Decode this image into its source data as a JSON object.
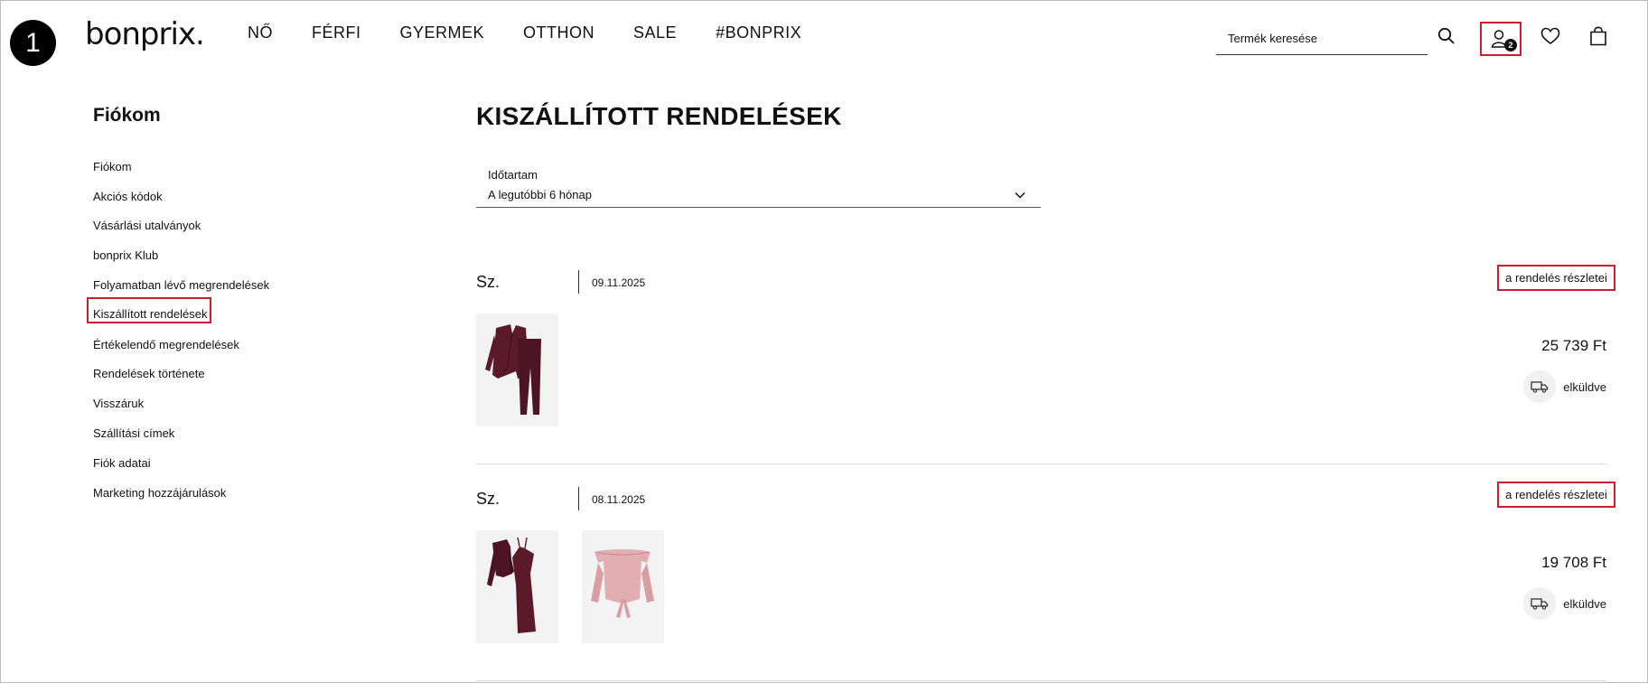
{
  "step": "1",
  "header": {
    "logo": "bonprix.",
    "nav": [
      "NŐ",
      "FÉRFI",
      "GYERMEK",
      "OTTHON",
      "SALE",
      "#BONPRIX"
    ],
    "search_placeholder": "Termék keresése",
    "account_count": "2"
  },
  "sidebar": {
    "title": "Fiókom",
    "items": [
      "Fiókom",
      "Akciós kódok",
      "Vásárlási utalványok",
      "bonprix Klub",
      "Folyamatban lévő megrendelések",
      "Kiszállított rendelések",
      "Értékelendő megrendelések",
      "Rendelések története",
      "Visszáruk",
      "Szállítási címek",
      "Fiók adatai",
      "Marketing hozzájárulások"
    ]
  },
  "main": {
    "title": "KISZÁLLÍTOTT RENDELÉSEK",
    "period_label": "Időtartam",
    "period_value": "A legutóbbi 6 hónap",
    "orders": [
      {
        "prefix": "Sz.",
        "date": "09.11.2025",
        "details": "a rendelés részletei",
        "price": "25 739 Ft",
        "status": "elküldve"
      },
      {
        "prefix": "Sz.",
        "date": "08.11.2025",
        "details": "a rendelés részletei",
        "price": "19 708 Ft",
        "status": "elküldve"
      }
    ]
  },
  "colors": {
    "accent": "#c8202f",
    "burgundy": "#5a1a2a",
    "pink": "#e3aeb1"
  }
}
